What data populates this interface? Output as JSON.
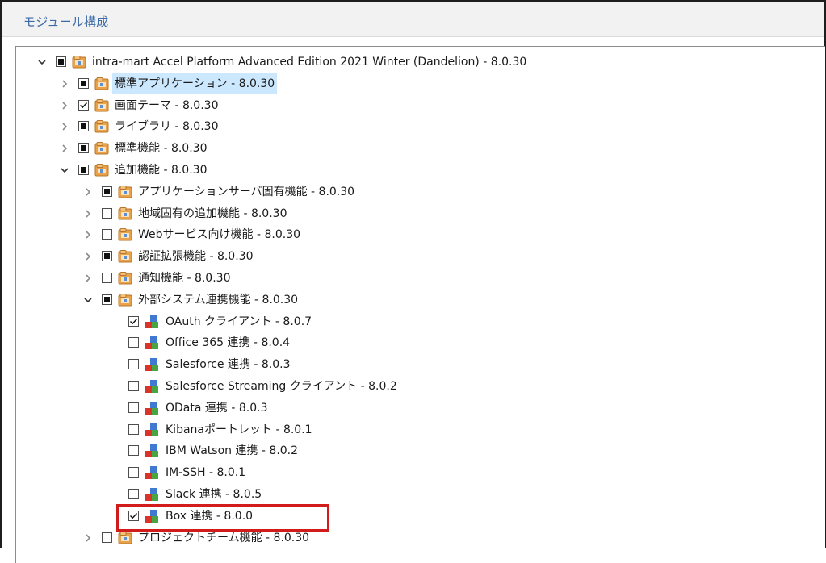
{
  "section": {
    "title": "モジュール構成"
  },
  "tree": {
    "root": {
      "label": "intra-mart Accel Platform Advanced Edition 2021 Winter (Dandelion) - 8.0.30",
      "state": "partial",
      "expanded": true
    },
    "level1": [
      {
        "label": "標準アプリケーション - 8.0.30",
        "state": "partial",
        "expanded": false,
        "selected": true
      },
      {
        "label": "画面テーマ - 8.0.30",
        "state": "checked",
        "expanded": false
      },
      {
        "label": "ライブラリ - 8.0.30",
        "state": "partial",
        "expanded": false
      },
      {
        "label": "標準機能 - 8.0.30",
        "state": "partial",
        "expanded": false
      },
      {
        "label": "追加機能 - 8.0.30",
        "state": "partial",
        "expanded": true
      }
    ],
    "level2": [
      {
        "label": "アプリケーションサーバ固有機能 - 8.0.30",
        "state": "partial",
        "expanded": false
      },
      {
        "label": "地域固有の追加機能 - 8.0.30",
        "state": "unchecked",
        "expanded": false
      },
      {
        "label": "Webサービス向け機能 - 8.0.30",
        "state": "unchecked",
        "expanded": false
      },
      {
        "label": "認証拡張機能 - 8.0.30",
        "state": "partial",
        "expanded": false
      },
      {
        "label": "通知機能 - 8.0.30",
        "state": "unchecked",
        "expanded": false
      },
      {
        "label": "外部システム連携機能 - 8.0.30",
        "state": "partial",
        "expanded": true
      }
    ],
    "leaves": [
      {
        "label": "OAuth クライアント - 8.0.7",
        "state": "checked"
      },
      {
        "label": "Office 365 連携 - 8.0.4",
        "state": "unchecked"
      },
      {
        "label": "Salesforce 連携 - 8.0.3",
        "state": "unchecked"
      },
      {
        "label": "Salesforce Streaming クライアント - 8.0.2",
        "state": "unchecked"
      },
      {
        "label": "OData 連携 - 8.0.3",
        "state": "unchecked"
      },
      {
        "label": "Kibanaポートレット - 8.0.1",
        "state": "unchecked"
      },
      {
        "label": "IBM Watson 連携 - 8.0.2",
        "state": "unchecked"
      },
      {
        "label": "IM-SSH - 8.0.1",
        "state": "unchecked"
      },
      {
        "label": "Slack 連携 - 8.0.5",
        "state": "unchecked"
      },
      {
        "label": "Box 連携 - 8.0.0",
        "state": "checked"
      }
    ],
    "after": [
      {
        "label": "プロジェクトチーム機能 - 8.0.30",
        "state": "unchecked",
        "expanded": false
      }
    ]
  },
  "colors": {
    "title": "#3b6aa8",
    "selection": "#cce8ff",
    "highlight": "#d21b1b"
  },
  "icons": {
    "folder": "folder-package-icon",
    "module": "module-blocks-icon"
  }
}
